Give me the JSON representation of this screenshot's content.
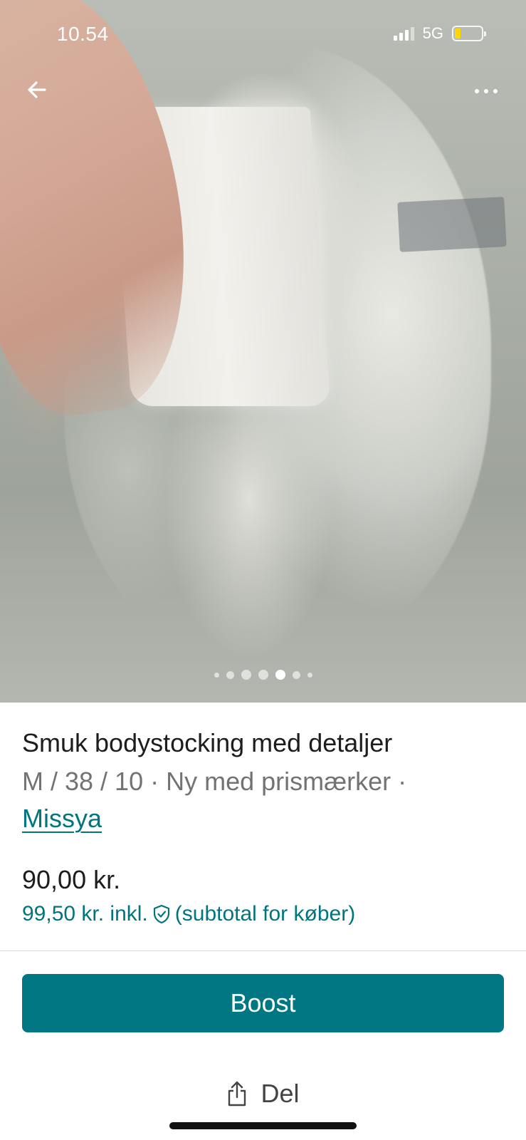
{
  "status_bar": {
    "time": "10.54",
    "network": "5G"
  },
  "icons": {
    "back": "arrow-left-icon",
    "more": "ellipsis-icon",
    "shield": "shield-check-icon",
    "share": "share-icon"
  },
  "gallery": {
    "image_count": 7,
    "active_index": 4
  },
  "listing": {
    "title": "Smuk bodystocking med detaljer",
    "meta": "M / 38 / 10 · Ny med prismærker ·",
    "brand": "Missya",
    "price": "90,00 kr.",
    "buyer_price_prefix": "99,50 kr. inkl.",
    "buyer_price_suffix": "(subtotal for køber)"
  },
  "actions": {
    "boost_label": "Boost",
    "share_label": "Del"
  },
  "colors": {
    "accent": "#007782",
    "link": "#00757e",
    "battery": "#ffd60a"
  }
}
